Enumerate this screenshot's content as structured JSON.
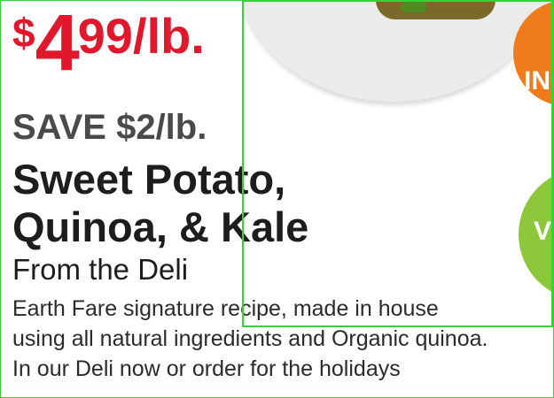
{
  "price": {
    "currency": "$",
    "dollars": "4",
    "rest": "99/lb."
  },
  "save_text": "SAVE $2/lb.",
  "product_name": {
    "line1": "Sweet Potato,",
    "line2": "Quinoa, & Kale"
  },
  "subtitle": "From the Deli",
  "description": {
    "line1": "Earth Fare signature recipe, made in house",
    "line2": "using all natural ingredients and Organic quinoa.",
    "line3": "In our Deli now or order for the holidays"
  },
  "badges": {
    "orange_text": "IN",
    "green_text": "V"
  },
  "colors": {
    "price_red": "#e1182c",
    "orange_badge": "#f07b1c",
    "green_badge": "#8cc83a",
    "frame_green": "#36d136"
  }
}
